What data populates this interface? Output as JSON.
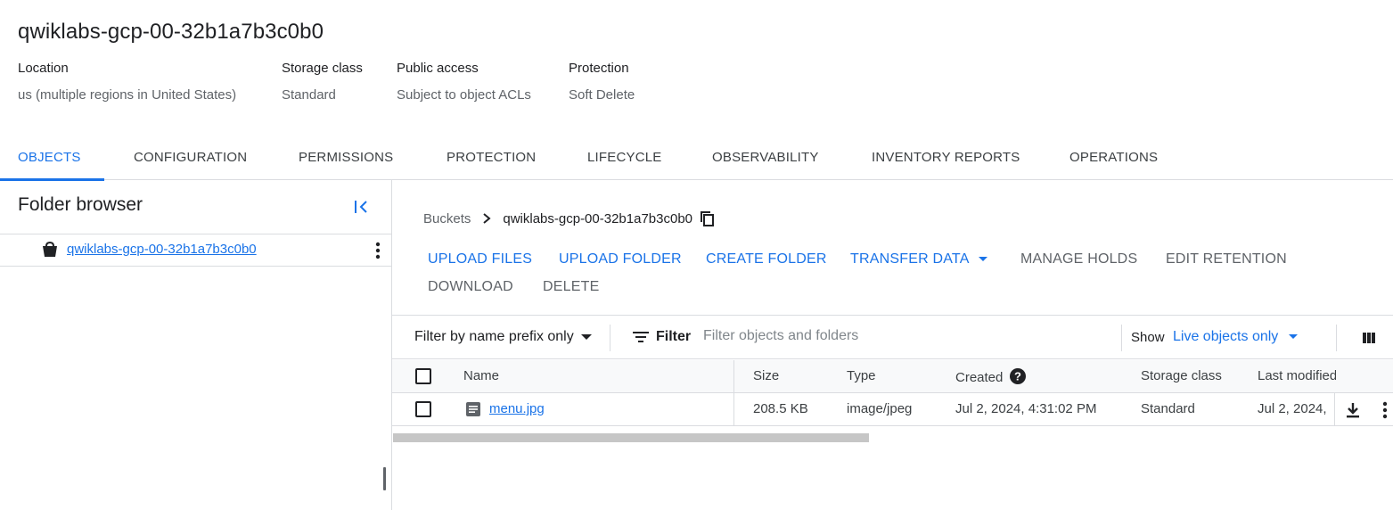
{
  "bucket": {
    "title": "qwiklabs-gcp-00-32b1a7b3c0b0",
    "meta": [
      {
        "label": "Location",
        "value": "us (multiple regions in United States)"
      },
      {
        "label": "Storage class",
        "value": "Standard"
      },
      {
        "label": "Public access",
        "value": "Subject to object ACLs"
      },
      {
        "label": "Protection",
        "value": "Soft Delete"
      }
    ]
  },
  "tabs": [
    {
      "label": "OBJECTS",
      "active": true
    },
    {
      "label": "CONFIGURATION"
    },
    {
      "label": "PERMISSIONS"
    },
    {
      "label": "PROTECTION"
    },
    {
      "label": "LIFECYCLE"
    },
    {
      "label": "OBSERVABILITY"
    },
    {
      "label": "INVENTORY REPORTS"
    },
    {
      "label": "OPERATIONS"
    }
  ],
  "sidebar": {
    "title": "Folder browser",
    "collapse_icon": "collapse-panel-icon",
    "bucket_name": "qwiklabs-gcp-00-32b1a7b3c0b0",
    "bucket_icon": "bucket-icon",
    "more_icon": "more-vert-icon"
  },
  "breadcrumb": {
    "root": "Buckets",
    "current": "qwiklabs-gcp-00-32b1a7b3c0b0",
    "copy_icon": "copy-icon"
  },
  "actions": {
    "upload_files": "UPLOAD FILES",
    "upload_folder": "UPLOAD FOLDER",
    "create_folder": "CREATE FOLDER",
    "transfer_data": "TRANSFER DATA",
    "manage_holds": "MANAGE HOLDS",
    "edit_retention": "EDIT RETENTION",
    "download": "DOWNLOAD",
    "delete": "DELETE"
  },
  "filter": {
    "prefix_mode": "Filter by name prefix only",
    "filter_label": "Filter",
    "placeholder": "Filter objects and folders",
    "show_label": "Show",
    "show_value": "Live objects only"
  },
  "table": {
    "columns": {
      "name": "Name",
      "size": "Size",
      "type": "Type",
      "created": "Created",
      "storage_class": "Storage class",
      "last_modified": "Last modified"
    },
    "rows": [
      {
        "name": "menu.jpg",
        "size": "208.5 KB",
        "type": "image/jpeg",
        "created": "Jul 2, 2024, 4:31:02 PM",
        "storage_class": "Standard",
        "last_modified": "Jul 2, 2024,"
      }
    ]
  },
  "colors": {
    "accent": "#1a73e8",
    "text": "#202124",
    "muted": "#5f6368",
    "border": "#dadce0"
  }
}
